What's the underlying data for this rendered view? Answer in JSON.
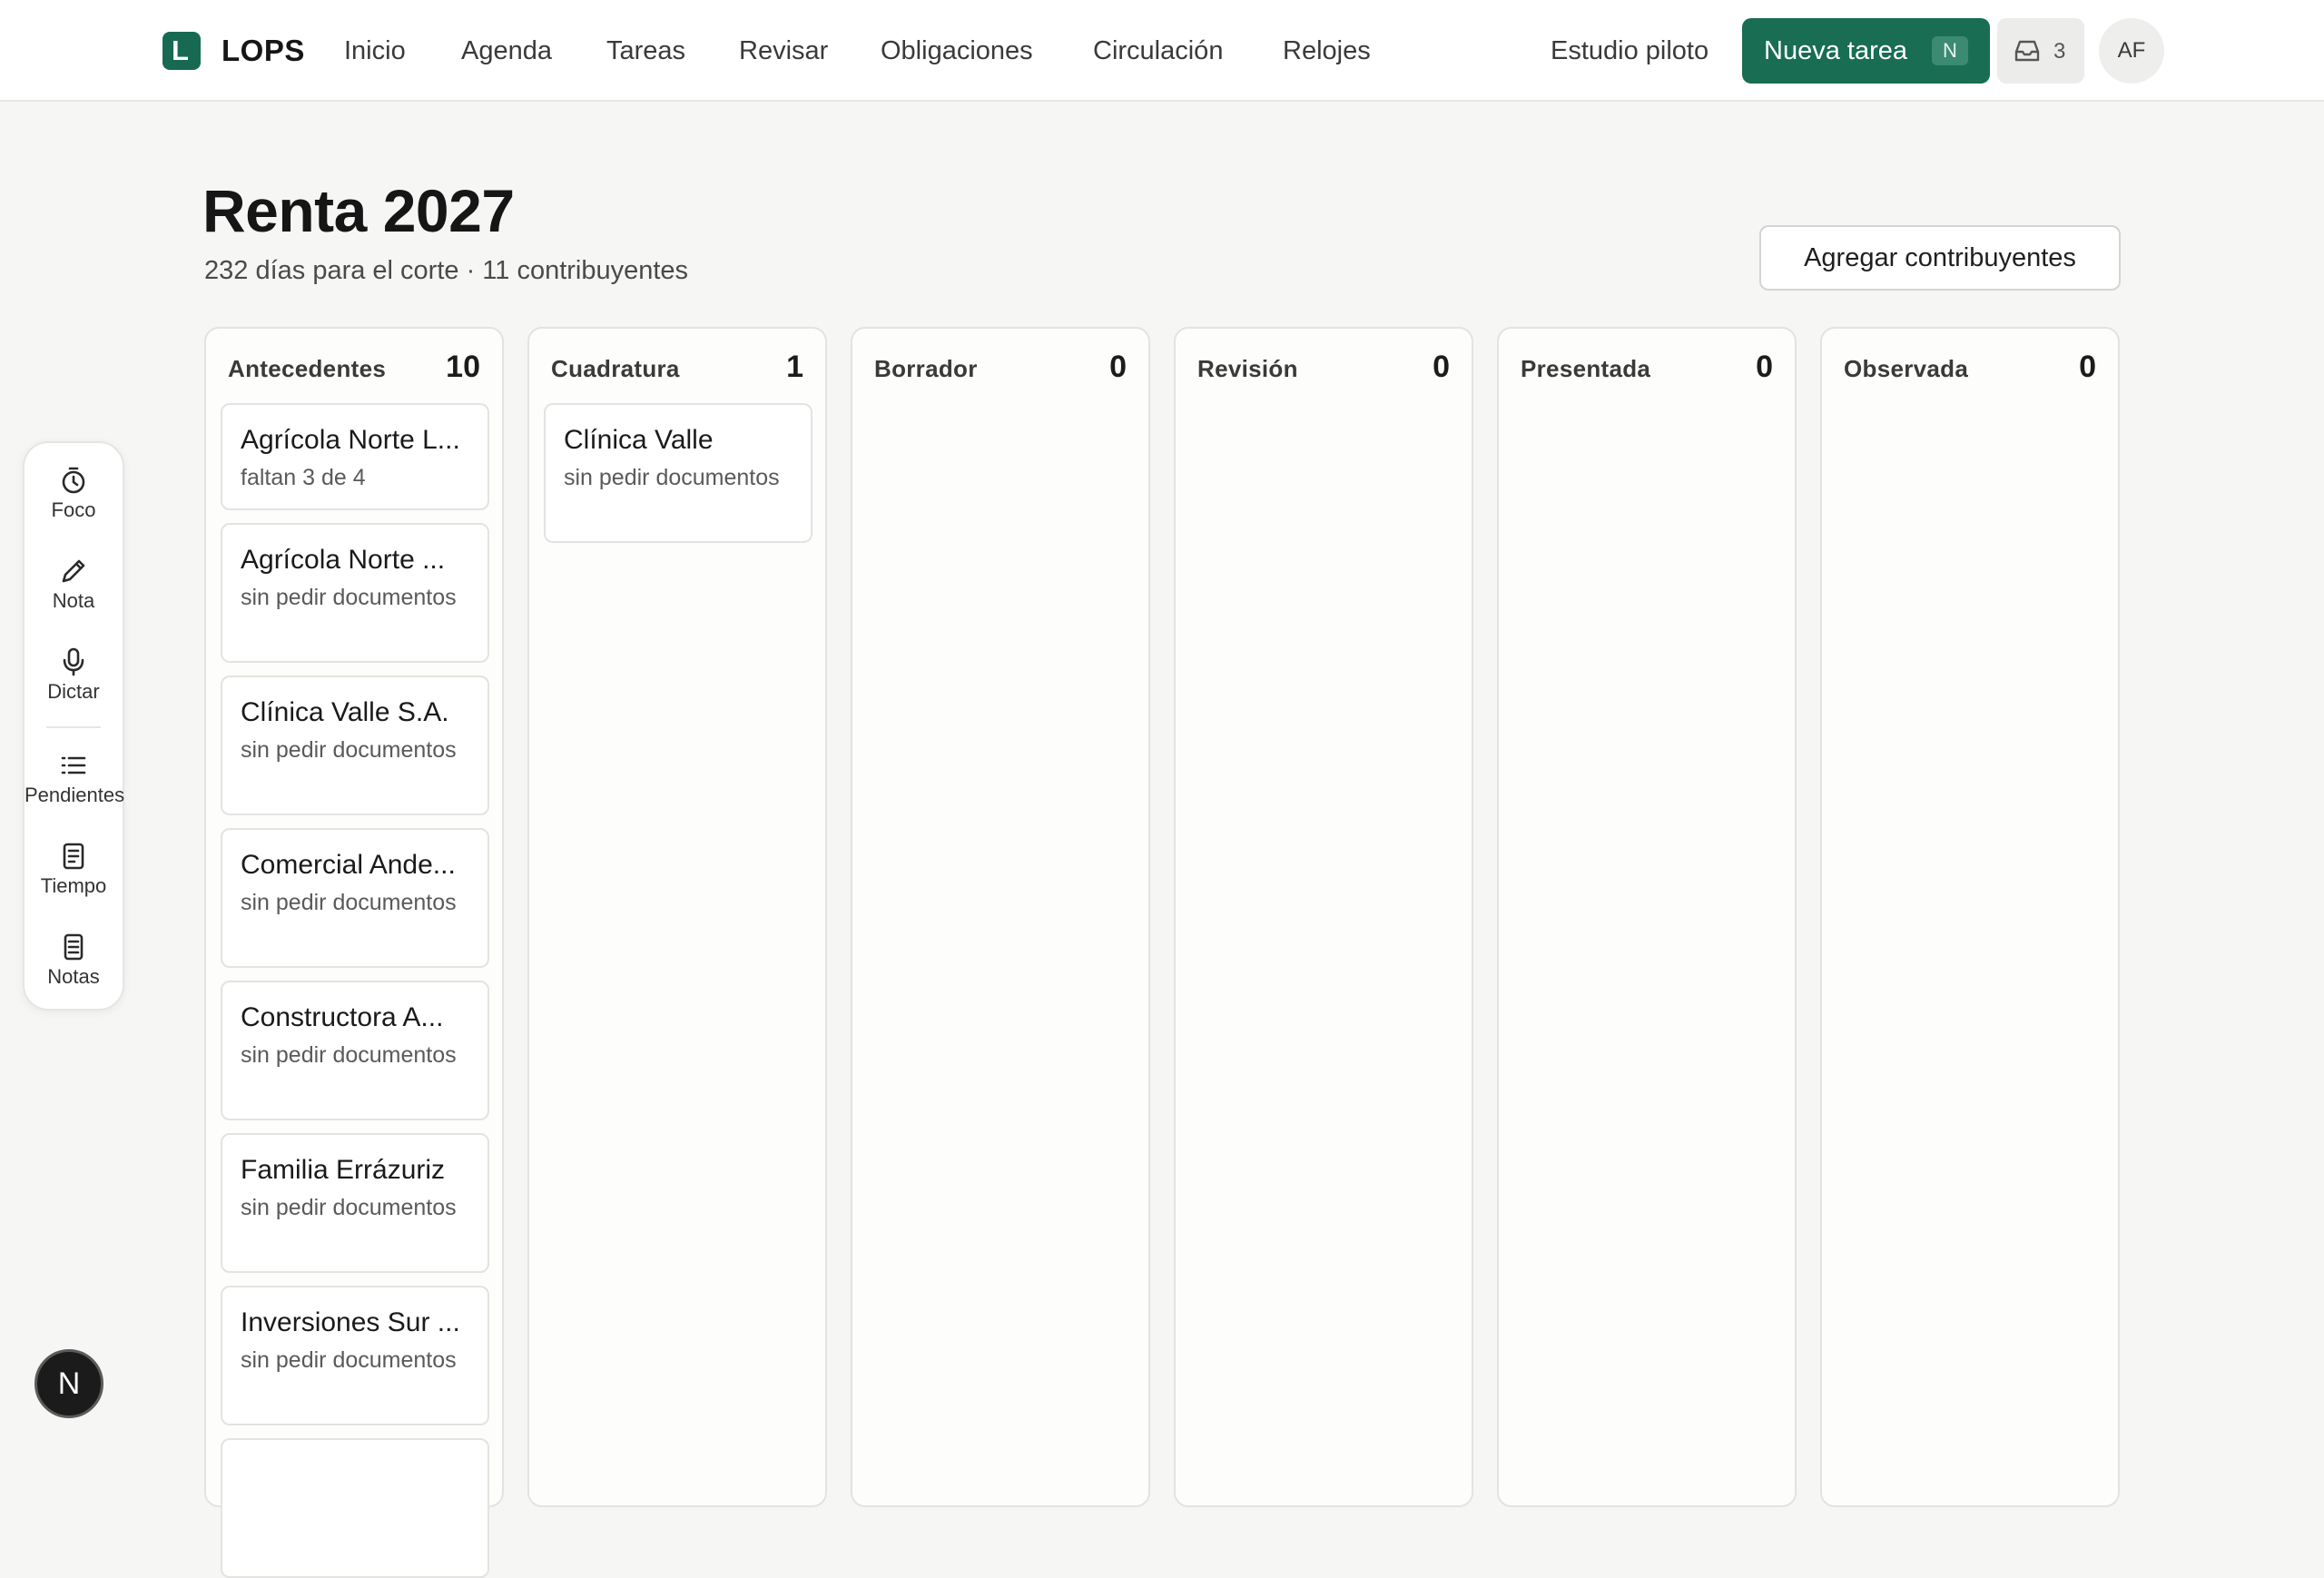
{
  "header": {
    "brand": "LOPS",
    "logo_letter": "L",
    "nav": [
      "Inicio",
      "Agenda",
      "Tareas",
      "Revisar",
      "Obligaciones",
      "Circulación",
      "Relojes"
    ],
    "workspace": "Estudio piloto",
    "new_task_label": "Nueva tarea",
    "new_task_shortcut": "N",
    "inbox_count": "3",
    "avatar_initials": "AF"
  },
  "page": {
    "title": "Renta 2027",
    "subtitle": "232 días para el corte · 11 contribuyentes",
    "add_button": "Agregar contribuyentes"
  },
  "columns": [
    {
      "title": "Antecedentes",
      "count": "10",
      "cards": [
        {
          "title": "Agrícola Norte L...",
          "status": "faltan 3 de 4"
        },
        {
          "title": "Agrícola Norte ...",
          "status": "sin pedir documentos"
        },
        {
          "title": "Clínica Valle S.A.",
          "status": "sin pedir documentos"
        },
        {
          "title": "Comercial Ande...",
          "status": "sin pedir documentos"
        },
        {
          "title": "Constructora A...",
          "status": "sin pedir documentos"
        },
        {
          "title": "Familia Errázuriz",
          "status": "sin pedir documentos"
        },
        {
          "title": "Inversiones Sur ...",
          "status": "sin pedir documentos"
        }
      ]
    },
    {
      "title": "Cuadratura",
      "count": "1",
      "cards": [
        {
          "title": "Clínica Valle",
          "status": "sin pedir documentos"
        }
      ]
    },
    {
      "title": "Borrador",
      "count": "0",
      "cards": []
    },
    {
      "title": "Revisión",
      "count": "0",
      "cards": []
    },
    {
      "title": "Presentada",
      "count": "0",
      "cards": []
    },
    {
      "title": "Observada",
      "count": "0",
      "cards": []
    }
  ],
  "tools": [
    {
      "label": "Foco",
      "icon": "timer-icon"
    },
    {
      "label": "Nota",
      "icon": "pencil-icon"
    },
    {
      "label": "Dictar",
      "icon": "microphone-icon"
    },
    {
      "label": "Pendientes",
      "icon": "list-icon"
    },
    {
      "label": "Tiempo",
      "icon": "document-icon"
    },
    {
      "label": "Notas",
      "icon": "notes-icon"
    }
  ],
  "bubble_letter": "N",
  "colors": {
    "brand": "#186d52",
    "background": "#f6f6f5",
    "card_border": "#e3e3e1"
  }
}
